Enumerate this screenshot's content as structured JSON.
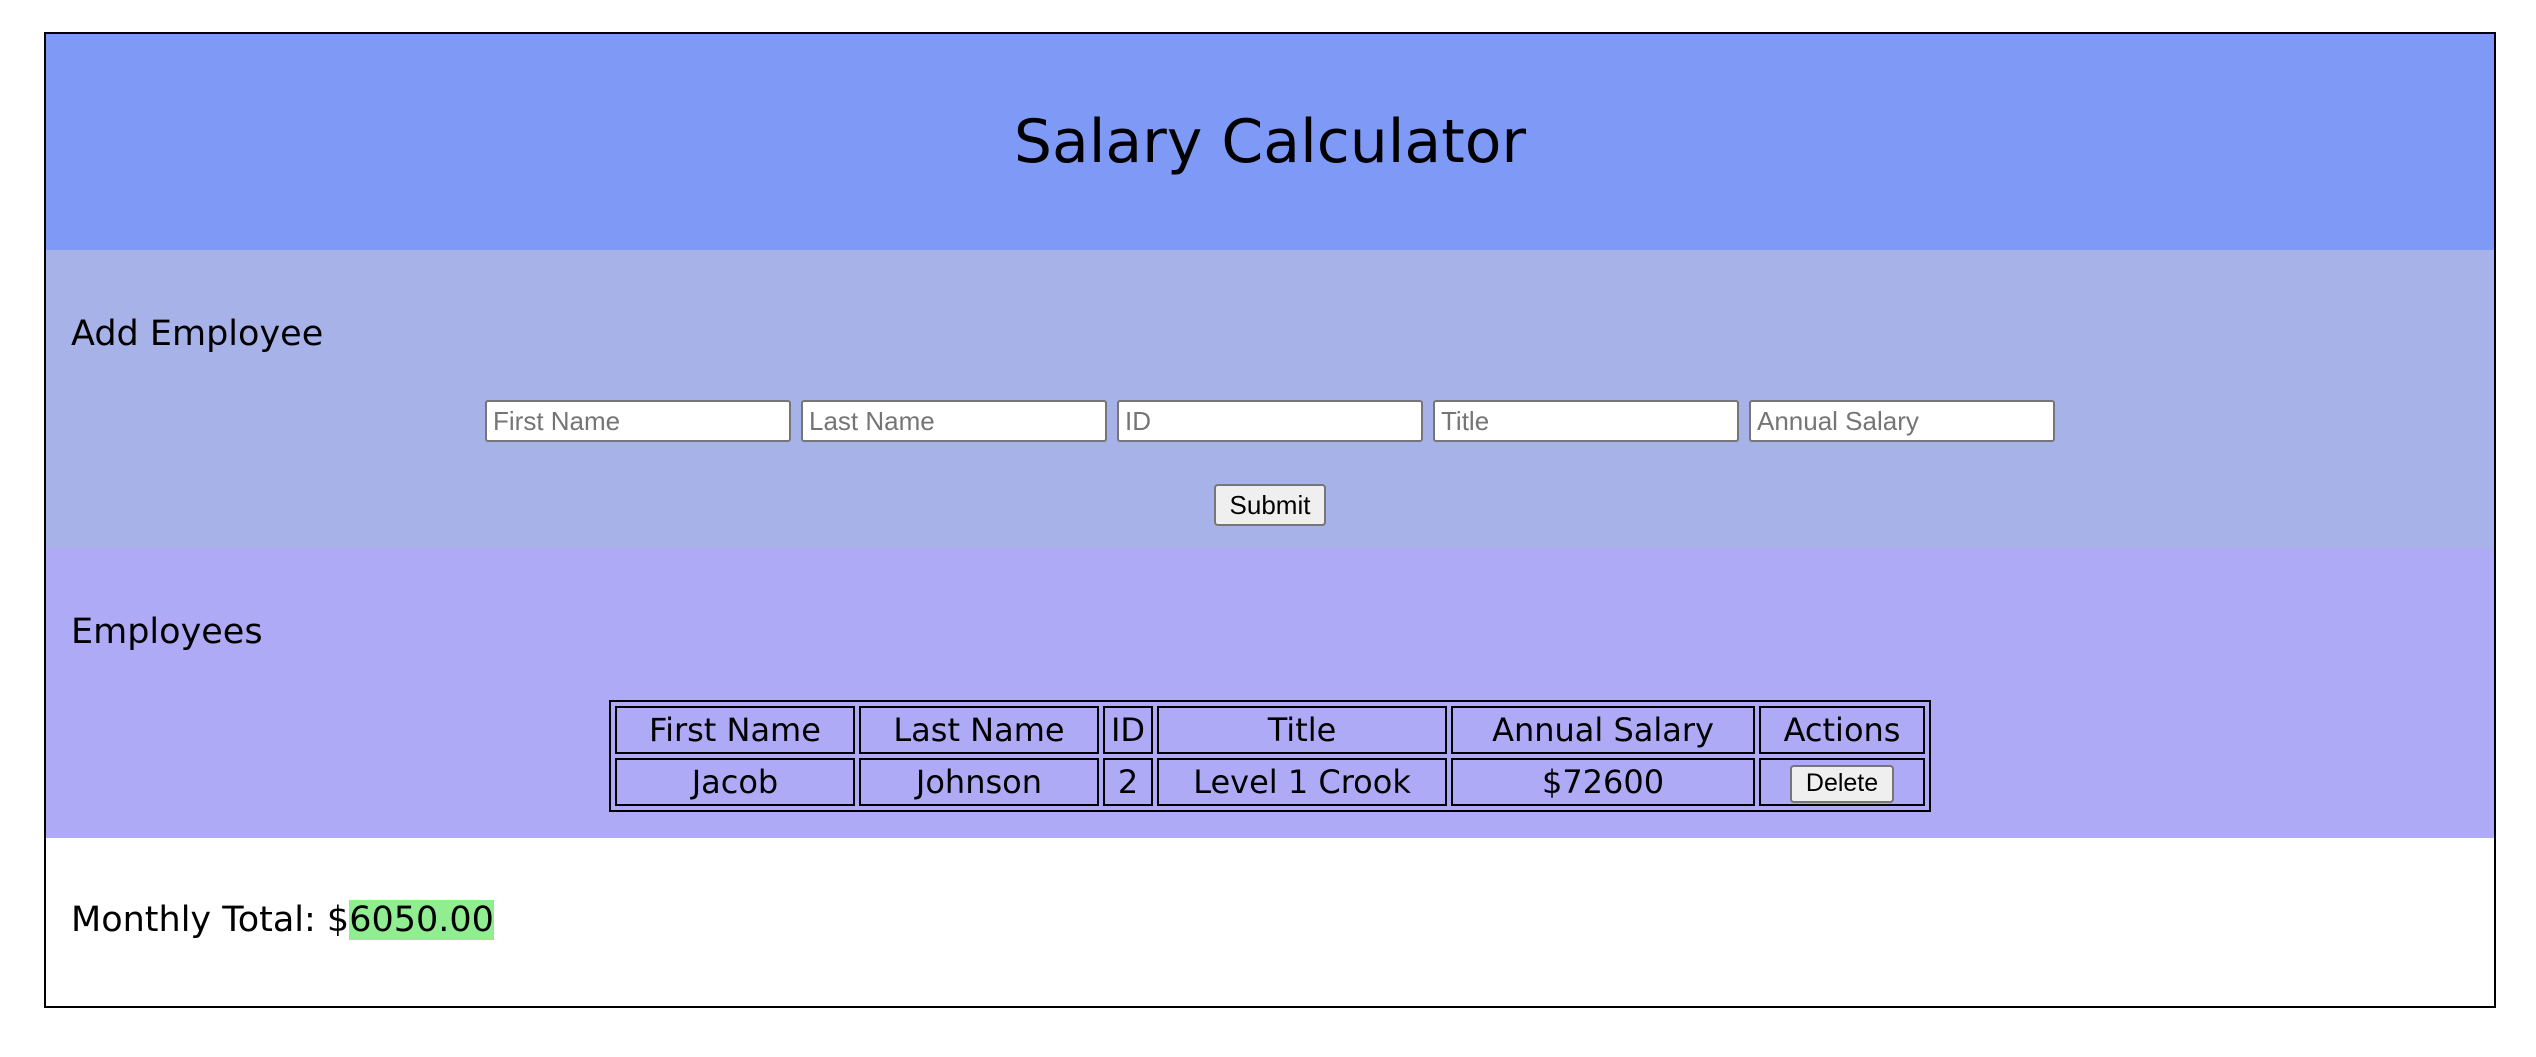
{
  "header": {
    "title": "Salary Calculator",
    "background": "#7f9af6"
  },
  "add_employee": {
    "title": "Add Employee",
    "background": "#a7b3e8",
    "fields": [
      {
        "name": "first-name",
        "placeholder": "First Name",
        "value": ""
      },
      {
        "name": "last-name",
        "placeholder": "Last Name",
        "value": ""
      },
      {
        "name": "id",
        "placeholder": "ID",
        "value": ""
      },
      {
        "name": "title",
        "placeholder": "Title",
        "value": ""
      },
      {
        "name": "annual-salary",
        "placeholder": "Annual Salary",
        "value": ""
      }
    ],
    "submit_label": "Submit"
  },
  "employees": {
    "title": "Employees",
    "background": "#aeaaf6",
    "columns": [
      "First Name",
      "Last Name",
      "ID",
      "Title",
      "Annual Salary",
      "Actions"
    ],
    "rows": [
      {
        "first_name": "Jacob",
        "last_name": "Johnson",
        "id": "2",
        "title": "Level 1 Crook",
        "annual_salary": "$72600",
        "action_label": "Delete"
      }
    ]
  },
  "monthly_total": {
    "label": "Monthly Total: $",
    "value": "6050.00",
    "highlight_color": "#90ee90"
  }
}
